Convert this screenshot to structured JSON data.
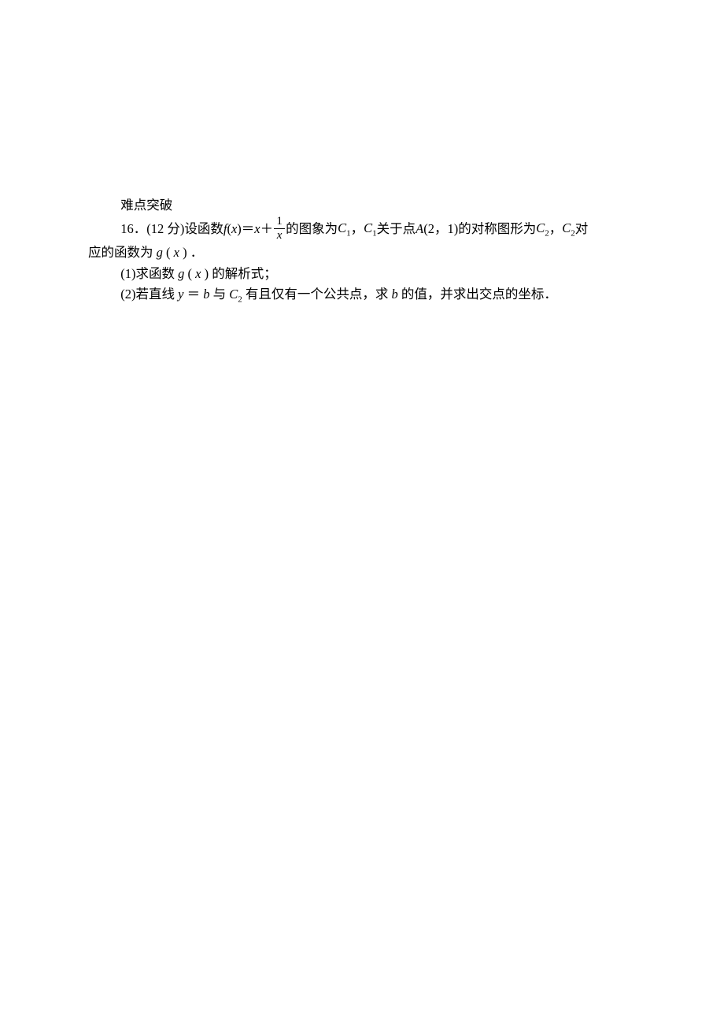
{
  "section_title": "难点突破",
  "problem": {
    "number": "16．",
    "points": "(12 分)",
    "intro1": "设函数 ",
    "func_f": "f",
    "paren_open": "(",
    "var_x": "x",
    "paren_close": ")",
    "eq": "＝",
    "plus": "＋",
    "frac_num": "1",
    "frac_den": "x",
    "intro2": "的图象为 ",
    "c1": "C",
    "sub1": "1",
    "intro3": "，",
    "c1b": "C",
    "sub1b": "1",
    "intro4": " 关于点 ",
    "a_label": "A",
    "a_coords": "(2，1)",
    "intro5": " 的对称图形为 ",
    "c2": "C",
    "sub2": "2",
    "intro6": "，",
    "c2b": "C",
    "sub2b": "2",
    "intro7": " 对",
    "line2a": "应的函数为 ",
    "func_g": "g",
    "line2b": "．",
    "q1_prefix": "(1)求函数 ",
    "q1_suffix": " 的解析式；",
    "q2_prefix": "(2)若直线 ",
    "var_y": "y",
    "var_b": "b",
    "q2_mid1": " 与 ",
    "q2_mid2": " 有且仅有一个公共点，求 ",
    "q2_suffix": " 的值，并求出交点的坐标．"
  }
}
